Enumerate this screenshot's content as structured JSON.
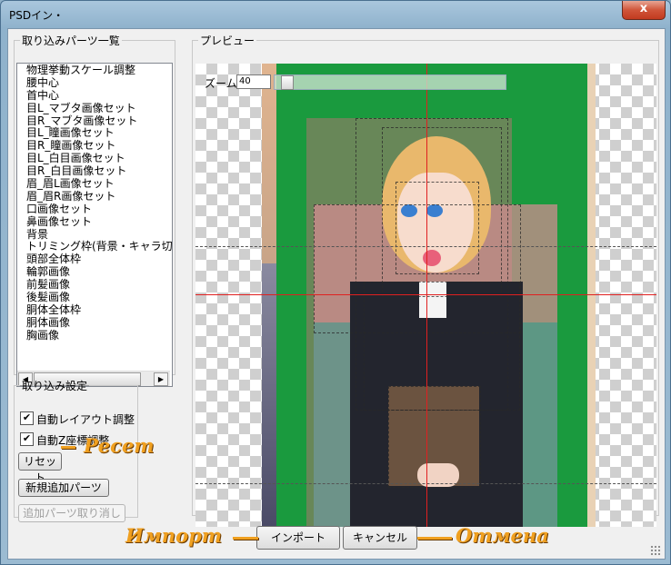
{
  "window": {
    "title": "PSDイン・",
    "close_glyph": "x"
  },
  "parts_panel": {
    "legend": "取り込みパーツ一覧",
    "items": [
      "物理挙動スケール調整",
      "腰中心",
      "首中心",
      "目L_マブタ画像セット",
      "目R_マブタ画像セット",
      "目L_瞳画像セット",
      "目R_瞳画像セット",
      "目L_白目画像セット",
      "目R_白目画像セット",
      "眉_眉L画像セット",
      "眉_眉R画像セット",
      "口画像セット",
      "鼻画像セット",
      "背景",
      "トリミング枠(背景・キャラ切り",
      "頭部全体枠",
      "輪郭画像",
      "前髪画像",
      "後髪画像",
      "胴体全体枠",
      "胴体画像",
      "胸画像"
    ],
    "scroll_left": "◀",
    "scroll_right": "▶"
  },
  "settings_panel": {
    "legend": "取り込み設定",
    "auto_layout": {
      "label": "自動レイアウト調整",
      "checked": true,
      "mark": "✔"
    },
    "auto_z": {
      "label": "自動Z座標調整",
      "checked": true,
      "mark": "✔"
    },
    "reset_label": "リセット",
    "add_parts_label": "新規追加パーツ",
    "undo_parts_label": "追加パーツ取り消し"
  },
  "preview_panel": {
    "legend": "プレビュー",
    "zoom_label": "ズーム",
    "zoom_value": "40"
  },
  "footer": {
    "import_label": "インポート",
    "cancel_label": "キャンセル"
  },
  "annotations": {
    "reset": "Ресет",
    "import": "Импорт",
    "cancel": "Отмена"
  },
  "colors": {
    "background_green": "#1a9a3e",
    "crosshair": "#e02020",
    "annotation": "#f0a020"
  }
}
